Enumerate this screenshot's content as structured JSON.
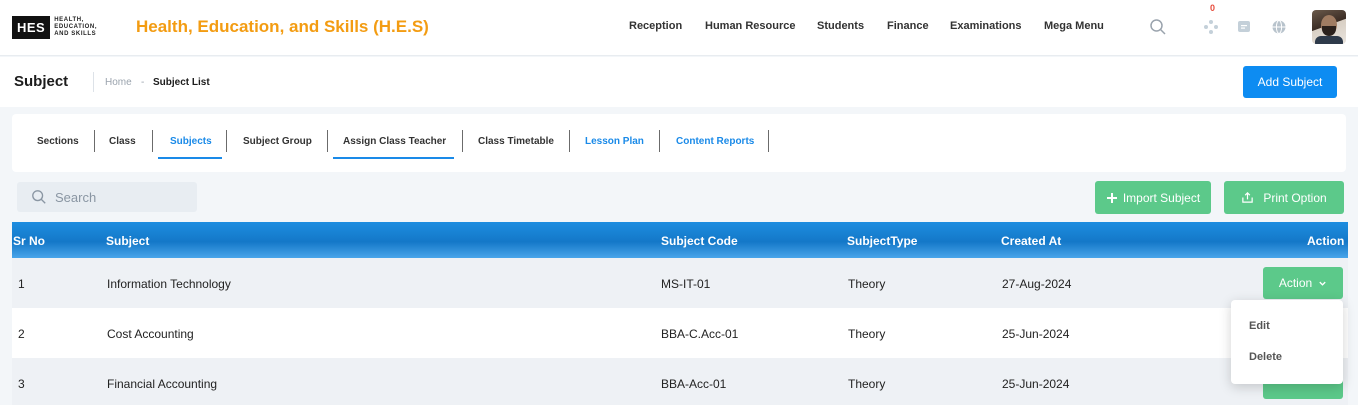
{
  "brand": {
    "logo_mark": "HES",
    "logo_text": "HEALTH, EDUCATION, AND SKILLS",
    "title": "Health, Education, and Skills (H.E.S)"
  },
  "nav": {
    "items": [
      "Reception",
      "Human Resource",
      "Students",
      "Finance",
      "Examinations",
      "Mega Menu"
    ]
  },
  "header_icons": {
    "search": "search-icon",
    "apps": "apps-icon",
    "apps_badge": "0",
    "messages": "chat-icon",
    "language": "globe-icon",
    "avatar": "user-avatar"
  },
  "subheader": {
    "title": "Subject",
    "breadcrumb_home": "Home",
    "breadcrumb_sep": "-",
    "breadcrumb_current": "Subject List",
    "add_button": "Add Subject"
  },
  "tabs": [
    {
      "label": "Sections",
      "active": false
    },
    {
      "label": "Class",
      "active": false
    },
    {
      "label": "Subjects",
      "active": true
    },
    {
      "label": "Subject Group",
      "active": false
    },
    {
      "label": "Assign Class Teacher",
      "active": false
    },
    {
      "label": "Class Timetable",
      "active": false
    },
    {
      "label": "Lesson Plan",
      "active": false
    },
    {
      "label": "Content Reports",
      "active": false
    }
  ],
  "toolbar": {
    "search_placeholder": "Search",
    "import_button": "Import Subject",
    "print_button": "Print Option"
  },
  "table": {
    "headers": [
      "Sr No",
      "Subject",
      "Subject Code",
      "SubjectType",
      "Created At",
      "Action"
    ],
    "rows": [
      {
        "sr": "1",
        "subject": "Information Technology",
        "code": "MS-IT-01",
        "type": "Theory",
        "created": "27-Aug-2024"
      },
      {
        "sr": "2",
        "subject": "Cost Accounting",
        "code": "BBA-C.Acc-01",
        "type": "Theory",
        "created": "25-Jun-2024"
      },
      {
        "sr": "3",
        "subject": "Financial Accounting",
        "code": "BBA-Acc-01",
        "type": "Theory",
        "created": "25-Jun-2024"
      }
    ],
    "action_button": "Action"
  },
  "action_menu": {
    "items": [
      "Edit",
      "Delete"
    ]
  },
  "colors": {
    "brand_orange": "#f39c12",
    "primary_blue": "#0d8cf2",
    "success_green": "#5cc98a",
    "badge_red": "#e74c3c"
  }
}
